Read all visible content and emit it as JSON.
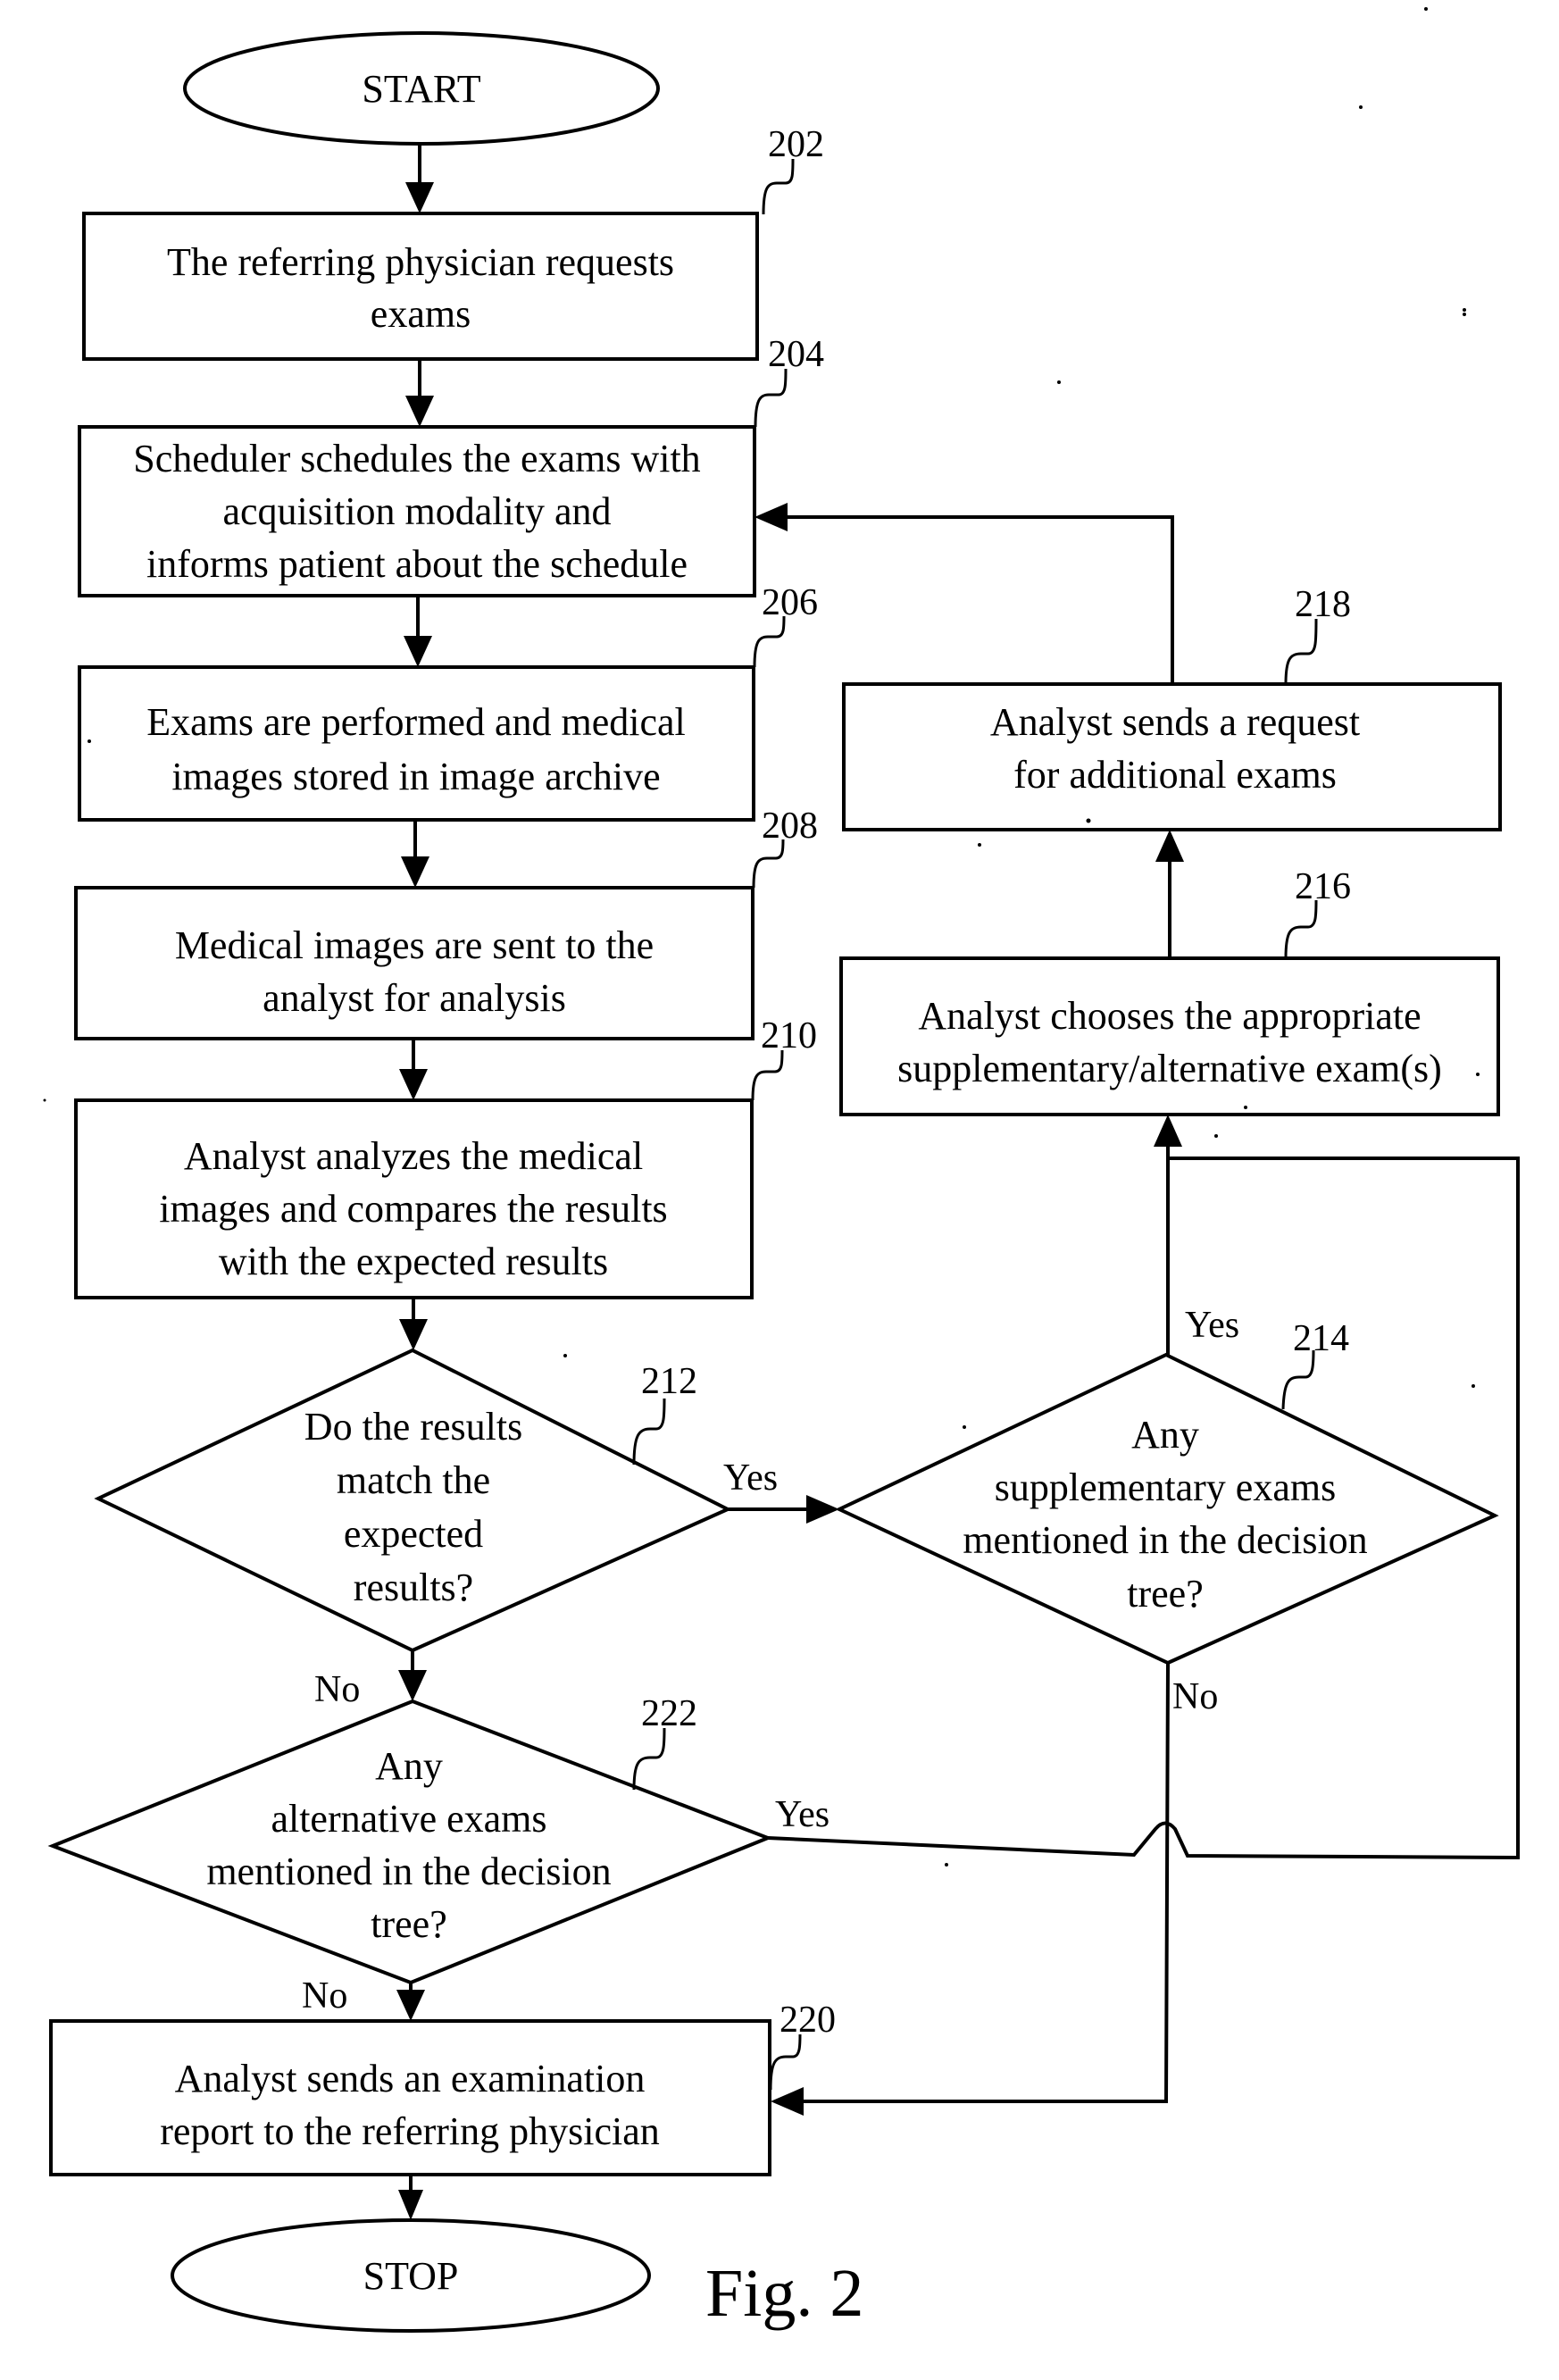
{
  "figure": {
    "caption": "Fig. 2",
    "type": "flowchart",
    "colors": {
      "ink": "#000000",
      "paper": "#ffffff"
    }
  },
  "nodes": {
    "start": {
      "label": "START",
      "shape": "terminator"
    },
    "n202": {
      "ref": "202",
      "shape": "process",
      "lines": [
        "The referring physician requests",
        "exams"
      ]
    },
    "n204": {
      "ref": "204",
      "shape": "process",
      "lines": [
        "Scheduler schedules the exams with",
        "acquisition modality and",
        "informs patient about the schedule"
      ]
    },
    "n206": {
      "ref": "206",
      "shape": "process",
      "lines": [
        "Exams are performed and medical",
        "images stored in image archive"
      ]
    },
    "n208": {
      "ref": "208",
      "shape": "process",
      "lines": [
        "Medical images are sent to the",
        "analyst for analysis"
      ]
    },
    "n210": {
      "ref": "210",
      "shape": "process",
      "lines": [
        "Analyst analyzes the medical",
        "images and compares the results",
        "with the expected results"
      ]
    },
    "n212": {
      "ref": "212",
      "shape": "decision",
      "lines": [
        "Do the results",
        "match the",
        "expected",
        "results?"
      ]
    },
    "n214": {
      "ref": "214",
      "shape": "decision",
      "lines": [
        "Any",
        "supplementary exams",
        "mentioned in the decision",
        "tree?"
      ]
    },
    "n216": {
      "ref": "216",
      "shape": "process",
      "lines": [
        "Analyst chooses the appropriate",
        "supplementary/alternative exam(s)"
      ]
    },
    "n218": {
      "ref": "218",
      "shape": "process",
      "lines": [
        "Analyst sends a request",
        "for additional exams"
      ]
    },
    "n220": {
      "ref": "220",
      "shape": "process",
      "lines": [
        "Analyst sends an examination",
        "report to the referring physician"
      ]
    },
    "n222": {
      "ref": "222",
      "shape": "decision",
      "lines": [
        "Any",
        "alternative exams",
        "mentioned in the decision",
        "tree?"
      ]
    },
    "stop": {
      "label": "STOP",
      "shape": "terminator"
    }
  },
  "edges": [
    {
      "from": "start",
      "to": "n202",
      "label": ""
    },
    {
      "from": "n202",
      "to": "n204",
      "label": ""
    },
    {
      "from": "n204",
      "to": "n206",
      "label": ""
    },
    {
      "from": "n206",
      "to": "n208",
      "label": ""
    },
    {
      "from": "n208",
      "to": "n210",
      "label": ""
    },
    {
      "from": "n210",
      "to": "n212",
      "label": ""
    },
    {
      "from": "n212",
      "to": "n214",
      "label": "Yes"
    },
    {
      "from": "n212",
      "to": "n222",
      "label": "No"
    },
    {
      "from": "n214",
      "to": "n216",
      "label": "Yes"
    },
    {
      "from": "n214",
      "to": "n220",
      "label": "No"
    },
    {
      "from": "n216",
      "to": "n218",
      "label": ""
    },
    {
      "from": "n218",
      "to": "n204",
      "label": ""
    },
    {
      "from": "n222",
      "to": "n216",
      "label": "Yes"
    },
    {
      "from": "n222",
      "to": "n220",
      "label": "No"
    },
    {
      "from": "n220",
      "to": "stop",
      "label": ""
    }
  ],
  "branch_labels": {
    "yes_212": "Yes",
    "no_212": "No",
    "yes_214": "Yes",
    "no_214": "No",
    "yes_222": "Yes",
    "no_222": "No"
  }
}
